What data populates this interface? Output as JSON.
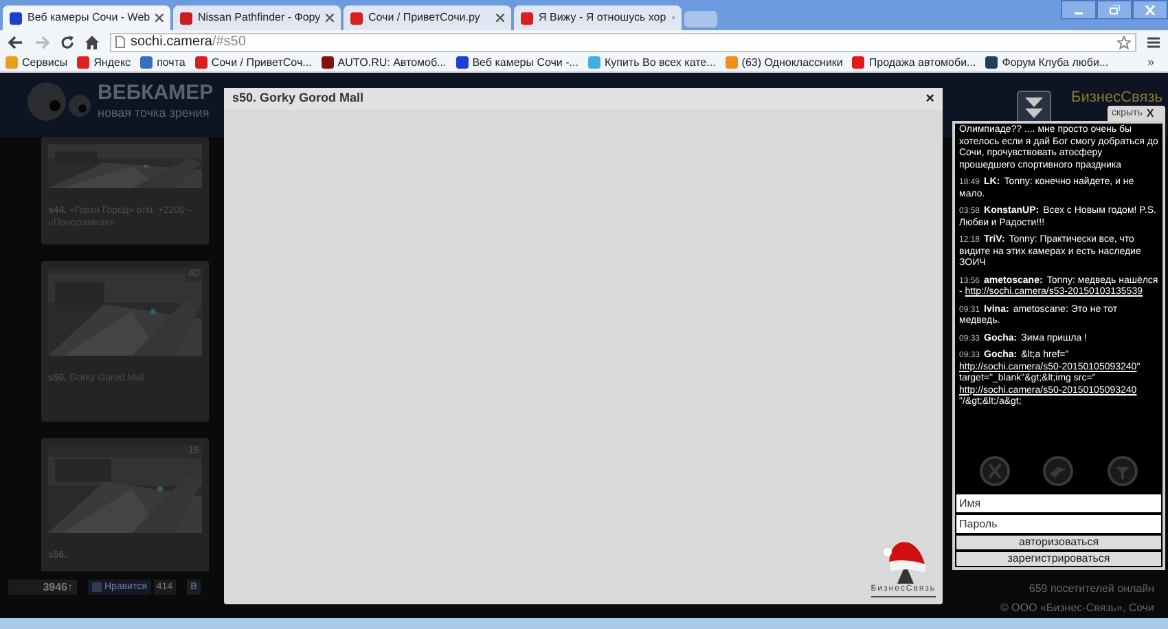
{
  "browser": {
    "tabs": [
      {
        "title": "Веб камеры Сочи - Web",
        "selected": true,
        "color": "#1a3fd0"
      },
      {
        "title": "Nissan Pathfinder - Фору",
        "selected": false,
        "color": "#c81e1e"
      },
      {
        "title": "Сочи / ПриветСочи.ру",
        "selected": false,
        "color": "#d92020"
      },
      {
        "title": "Я Вижу - Я отношусь хор",
        "selected": false,
        "color": "#d92020"
      }
    ],
    "url": {
      "host": "sochi.camera",
      "path": "/#s50"
    },
    "bookmarks": [
      {
        "label": "Сервисы",
        "color": "#e8a020"
      },
      {
        "label": "Яндекс",
        "color": "#e02020"
      },
      {
        "label": "почта",
        "color": "#3a6fc0"
      },
      {
        "label": "Сочи / ПриветСоч...",
        "color": "#d92020"
      },
      {
        "label": "AUTO.RU: Автомоб...",
        "color": "#8a1010"
      },
      {
        "label": "Веб камеры Сочи -...",
        "color": "#1a3fd0"
      },
      {
        "label": "Купить Во всех кате...",
        "color": "#40b0e0"
      },
      {
        "label": "(63) Одноклассники",
        "color": "#f0901a"
      },
      {
        "label": "Продажа автомоби...",
        "color": "#e01818"
      },
      {
        "label": "Форум Клуба люби...",
        "color": "#1e4060"
      }
    ],
    "bookmarks_more": "»"
  },
  "site": {
    "logo_title": "ВЕБКАМЕР",
    "logo_subtitle": "новая точка зрения",
    "partner_logo": "БизнесСвязь",
    "cards": [
      {
        "title": "**s44.** «Горки Город» отм. +2200 – «Панорамная»"
      },
      {
        "title": "**s50.** Gorky Gorod Mall",
        "badge": "40"
      },
      {
        "title": "**s56.**",
        "badge": "15"
      }
    ],
    "counter": "3946↑",
    "like_label": "Нравится",
    "like_count": "414",
    "vk_label": "В",
    "footer": [
      "659 посетителей онлайн",
      "© ООО «Бизнес-Связь», Сочи"
    ]
  },
  "modal": {
    "title": "s50. Gorky Gorod Mall",
    "close": "×",
    "logo_text": "БизнесСвязь"
  },
  "chat": {
    "hide_label": "скрыть",
    "hide_close": "X",
    "messages": [
      {
        "parts": [
          {
            "kind": "text",
            "text": "Олимпиаде?? .... мне просто очень бы хотелось если я дай Бог смогу добраться до Сочи, прочувствовать атосферу прошедшего спортивного праздника"
          }
        ]
      },
      {
        "time": "18:49",
        "author": "LK:",
        "parts": [
          {
            "kind": "text",
            "text": "Tonny: конечно найдете, и не мало."
          }
        ]
      },
      {
        "time": "03:58",
        "author": "KonstanUP:",
        "parts": [
          {
            "kind": "text",
            "text": "Всех с Новым годом! P.S. Любви и Радости!!!"
          }
        ]
      },
      {
        "time": "12:18",
        "author": "TriV:",
        "parts": [
          {
            "kind": "text",
            "text": "Tonny: Практически все, что видите на этих камерах и есть наследие ЗОИЧ"
          }
        ]
      },
      {
        "time": "13:56",
        "author": "ametoscane:",
        "parts": [
          {
            "kind": "text",
            "text": "Tonny: медведь нашёлся - "
          },
          {
            "kind": "link",
            "text": "http://sochi.camera/s53-20150103135539"
          }
        ]
      },
      {
        "time": "09:31",
        "author": "lvina:",
        "parts": [
          {
            "kind": "text",
            "text": "ametoscane: Это не тот медведь."
          }
        ]
      },
      {
        "time": "09:33",
        "author": "Gocha:",
        "parts": [
          {
            "kind": "text",
            "text": "Зима пришла !"
          }
        ]
      },
      {
        "time": "09:33",
        "author": "Gocha:",
        "parts": [
          {
            "kind": "text",
            "text": "&lt;a href=\""
          },
          {
            "kind": "link",
            "text": "http://sochi.camera/s50-20150105093240"
          },
          {
            "kind": "text",
            "text": "\" target=\"_blank\"&gt;&lt;img src=\""
          },
          {
            "kind": "link",
            "text": "http://sochi.camera/s50-20150105093240"
          },
          {
            "kind": "text",
            "text": "\"/&gt;&lt;/a&gt;"
          }
        ]
      }
    ],
    "name_placeholder": "Имя",
    "password_placeholder": "Пароль",
    "buttons": [
      "авторизоваться",
      "зарегистрироваться"
    ]
  }
}
